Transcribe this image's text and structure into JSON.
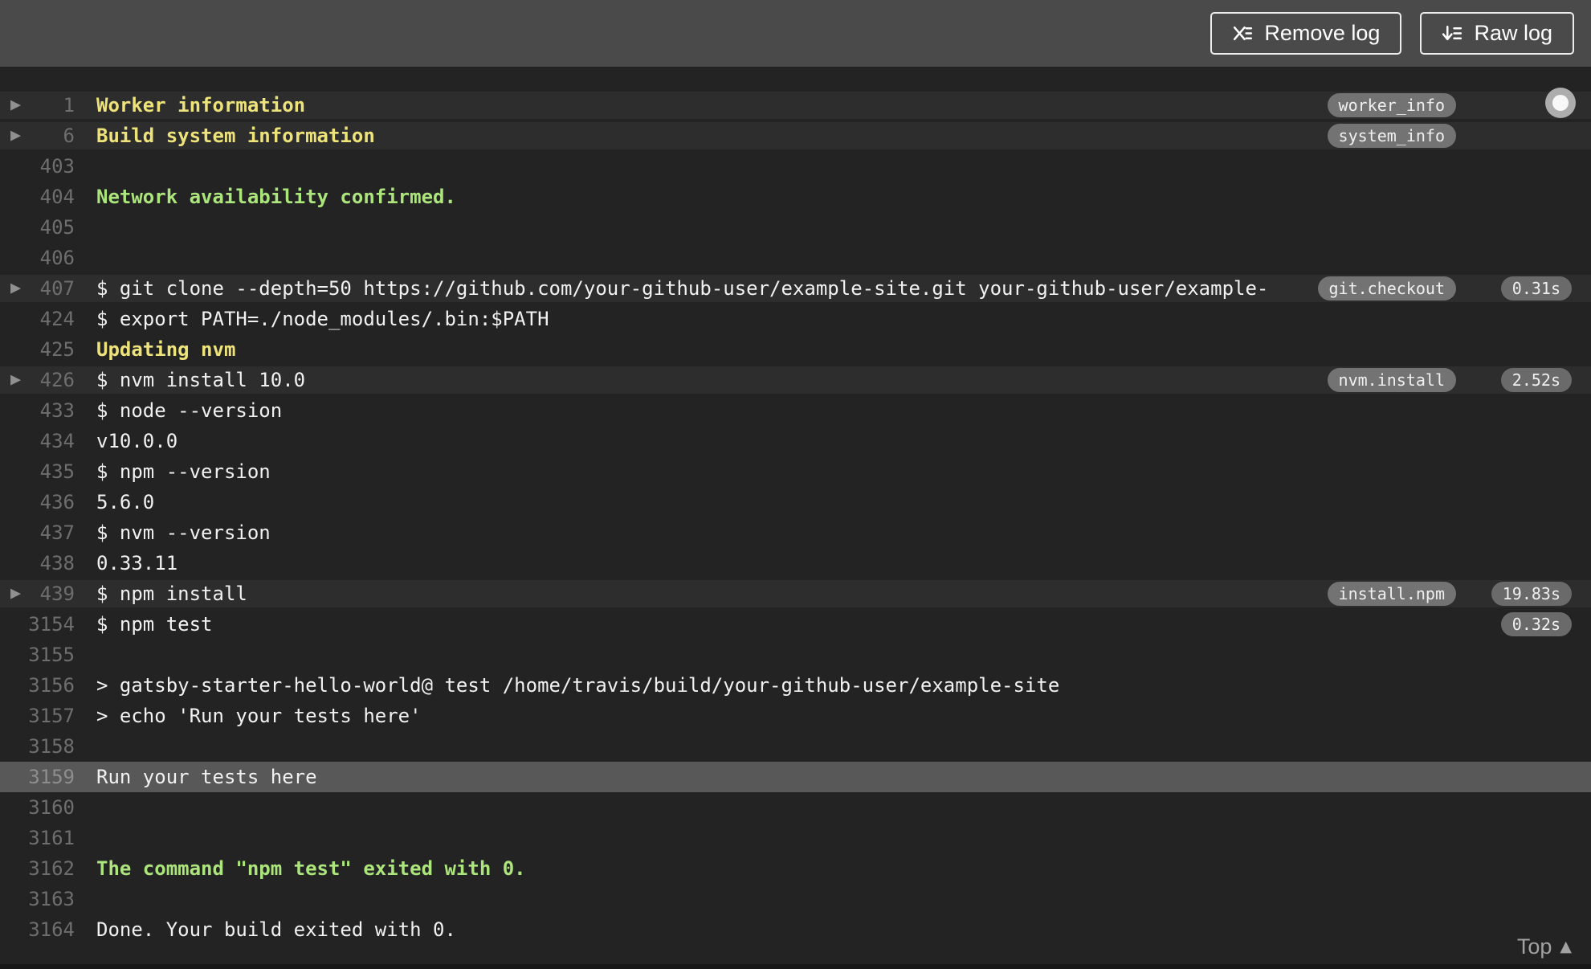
{
  "toolbar": {
    "remove_log_label": "Remove log",
    "raw_log_label": "Raw log"
  },
  "log": {
    "rows": [
      {
        "n": "1",
        "text": "Worker information",
        "style": "yellow",
        "fold": true,
        "badge": "worker_info"
      },
      {
        "n": "6",
        "text": "Build system information",
        "style": "yellow",
        "fold": true,
        "badge": "system_info"
      },
      {
        "n": "403",
        "text": ""
      },
      {
        "n": "404",
        "text": "Network availability confirmed.",
        "style": "green"
      },
      {
        "n": "405",
        "text": ""
      },
      {
        "n": "406",
        "text": ""
      },
      {
        "n": "407",
        "text": "$ git clone --depth=50 https://github.com/your-github-user/example-site.git your-github-user/example-",
        "fold": true,
        "badge": "git.checkout",
        "time": "0.31s"
      },
      {
        "n": "424",
        "text": "$ export PATH=./node_modules/.bin:$PATH"
      },
      {
        "n": "425",
        "text": "Updating nvm",
        "style": "yellow"
      },
      {
        "n": "426",
        "text": "$ nvm install 10.0",
        "fold": true,
        "badge": "nvm.install",
        "time": "2.52s"
      },
      {
        "n": "433",
        "text": "$ node --version"
      },
      {
        "n": "434",
        "text": "v10.0.0"
      },
      {
        "n": "435",
        "text": "$ npm --version"
      },
      {
        "n": "436",
        "text": "5.6.0"
      },
      {
        "n": "437",
        "text": "$ nvm --version"
      },
      {
        "n": "438",
        "text": "0.33.11"
      },
      {
        "n": "439",
        "text": "$ npm install",
        "fold": true,
        "badge": "install.npm",
        "time": "19.83s"
      },
      {
        "n": "3154",
        "text": "$ npm test",
        "time": "0.32s"
      },
      {
        "n": "3155",
        "text": ""
      },
      {
        "n": "3156",
        "text": "> gatsby-starter-hello-world@ test /home/travis/build/your-github-user/example-site"
      },
      {
        "n": "3157",
        "text": "> echo 'Run your tests here'"
      },
      {
        "n": "3158",
        "text": ""
      },
      {
        "n": "3159",
        "text": "Run your tests here",
        "highlight": true
      },
      {
        "n": "3160",
        "text": ""
      },
      {
        "n": "3161",
        "text": ""
      },
      {
        "n": "3162",
        "text": "The command \"npm test\" exited with 0.",
        "style": "green"
      },
      {
        "n": "3163",
        "text": ""
      },
      {
        "n": "3164",
        "text": "Done. Your build exited with 0."
      }
    ]
  },
  "footer": {
    "top_label": "Top",
    "top_caret": "▲"
  },
  "icons": {
    "fold_arrow": "▶",
    "remove_log": "x-list-icon",
    "raw_log": "download-list-icon",
    "scroll_toggle": "follow-log-dot-icon"
  },
  "colors": {
    "topbar_bg": "#4A4A4A",
    "log_bg": "#232323",
    "fold_row_bg": "#2D2D2D",
    "highlight_row_bg": "#585858",
    "line_number": "#6E6E6E",
    "text": "#F1F1F1",
    "yellow": "#EEE37A",
    "green": "#ADE57D",
    "badge_bg": "#737373",
    "time_badge_bg": "#6A6A6A"
  }
}
